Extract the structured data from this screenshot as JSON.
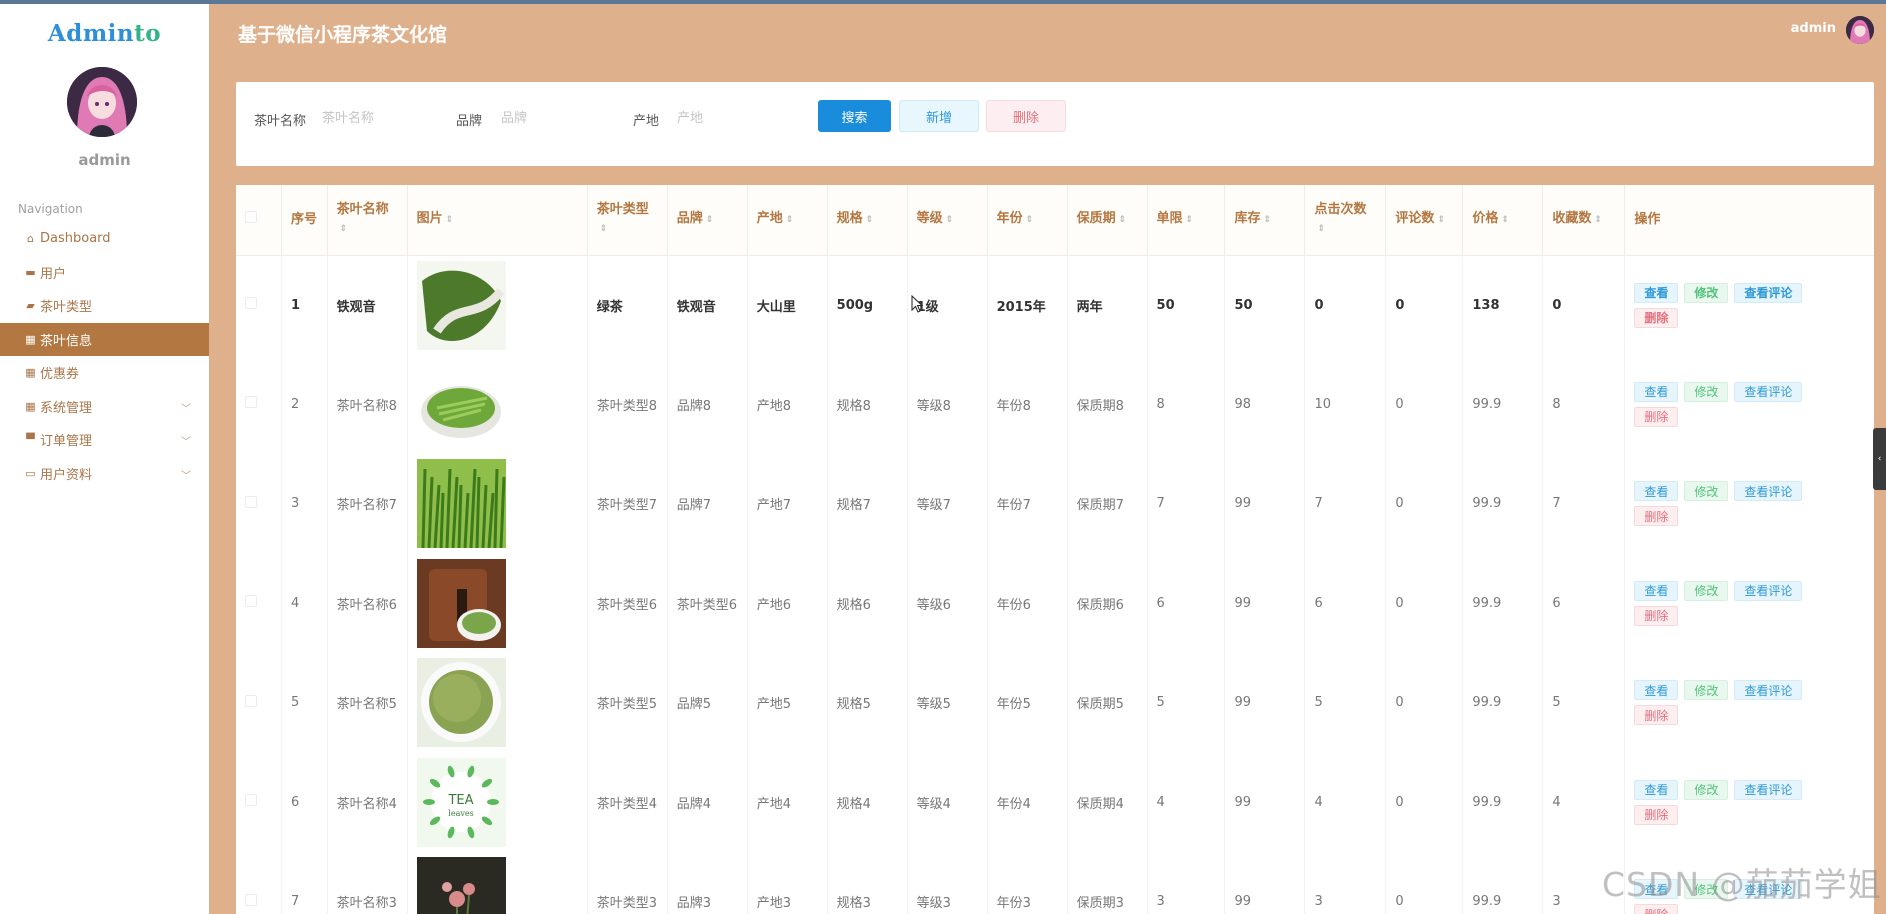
{
  "app": {
    "logo_main": "Admin",
    "logo_accent": "to",
    "title": "基于微信小程序茶文化馆",
    "header_user": "admin",
    "sidebar_user": "admin"
  },
  "sidebar": {
    "heading": "Navigation",
    "items": [
      {
        "label": "Dashboard",
        "icon": "home-icon",
        "glyph": "⌂",
        "active": false,
        "expandable": false
      },
      {
        "label": "用户",
        "icon": "briefcase-icon",
        "glyph": "▬",
        "active": false,
        "expandable": false
      },
      {
        "label": "茶叶类型",
        "icon": "video-icon",
        "glyph": "▰",
        "active": false,
        "expandable": false
      },
      {
        "label": "茶叶信息",
        "icon": "grid-icon",
        "glyph": "▦",
        "active": true,
        "expandable": false
      },
      {
        "label": "优惠券",
        "icon": "grid-icon",
        "glyph": "▦",
        "active": false,
        "expandable": false
      },
      {
        "label": "系统管理",
        "icon": "grid-icon",
        "glyph": "▦",
        "active": false,
        "expandable": true
      },
      {
        "label": "订单管理",
        "icon": "monitor-icon",
        "glyph": "▀",
        "active": false,
        "expandable": true
      },
      {
        "label": "用户资料",
        "icon": "card-icon",
        "glyph": "▭",
        "active": false,
        "expandable": true
      }
    ]
  },
  "search": {
    "fields": [
      {
        "label": "茶叶名称",
        "placeholder": "茶叶名称"
      },
      {
        "label": "品牌",
        "placeholder": "品牌"
      },
      {
        "label": "产地",
        "placeholder": "产地"
      }
    ],
    "search_label": "搜索",
    "add_label": "新增",
    "delete_label": "删除"
  },
  "table": {
    "columns": [
      "序号",
      "茶叶名称",
      "图片",
      "茶叶类型",
      "品牌",
      "产地",
      "规格",
      "等级",
      "年份",
      "保质期",
      "单限",
      "库存",
      "点击次数",
      "评论数",
      "价格",
      "收藏数",
      "操作"
    ],
    "actions": {
      "view": "查看",
      "edit": "修改",
      "comment": "查看评论",
      "delete": "删除"
    },
    "rows": [
      {
        "no": "1",
        "name": "铁观音",
        "type": "绿茶",
        "brand": "铁观音",
        "origin": "大山里",
        "spec": "500g",
        "grade": "1级",
        "year": "2015年",
        "shelf": "两年",
        "limit": "50",
        "stock": "50",
        "clicks": "0",
        "comments": "0",
        "price": "138",
        "favorites": "0",
        "image": {
          "bg": "#f4f6f0",
          "tea": "#4d7a2a",
          "style": "leaf-spoon"
        }
      },
      {
        "no": "2",
        "name": "茶叶名称8",
        "type": "茶叶类型8",
        "brand": "品牌8",
        "origin": "产地8",
        "spec": "规格8",
        "grade": "等级8",
        "year": "年份8",
        "shelf": "保质期8",
        "limit": "8",
        "stock": "98",
        "clicks": "10",
        "comments": "0",
        "price": "99.9",
        "favorites": "8",
        "image": {
          "bg": "#ffffff",
          "tea": "#6ea83a",
          "style": "bowl"
        }
      },
      {
        "no": "3",
        "name": "茶叶名称7",
        "type": "茶叶类型7",
        "brand": "品牌7",
        "origin": "产地7",
        "spec": "规格7",
        "grade": "等级7",
        "year": "年份7",
        "shelf": "保质期7",
        "limit": "7",
        "stock": "99",
        "clicks": "7",
        "comments": "0",
        "price": "99.9",
        "favorites": "7",
        "image": {
          "bg": "#8fbf4a",
          "tea": "#3d7a1c",
          "style": "sprouts"
        }
      },
      {
        "no": "4",
        "name": "茶叶名称6",
        "type": "茶叶类型6",
        "brand": "茶叶类型6",
        "origin": "产地6",
        "spec": "规格6",
        "grade": "等级6",
        "year": "年份6",
        "shelf": "保质期6",
        "limit": "6",
        "stock": "99",
        "clicks": "6",
        "comments": "0",
        "price": "99.9",
        "favorites": "6",
        "image": {
          "bg": "#6b3a22",
          "tea": "#7aa54a",
          "style": "jar"
        }
      },
      {
        "no": "5",
        "name": "茶叶名称5",
        "type": "茶叶类型5",
        "brand": "品牌5",
        "origin": "产地5",
        "spec": "规格5",
        "grade": "等级5",
        "year": "年份5",
        "shelf": "保质期5",
        "limit": "5",
        "stock": "99",
        "clicks": "5",
        "comments": "0",
        "price": "99.9",
        "favorites": "5",
        "image": {
          "bg": "#e9efe2",
          "tea": "#8aa352",
          "style": "plate"
        }
      },
      {
        "no": "6",
        "name": "茶叶名称4",
        "type": "茶叶类型4",
        "brand": "品牌4",
        "origin": "产地4",
        "spec": "规格4",
        "grade": "等级4",
        "year": "年份4",
        "shelf": "保质期4",
        "limit": "4",
        "stock": "99",
        "clicks": "4",
        "comments": "0",
        "price": "99.9",
        "favorites": "4",
        "image": {
          "bg": "#f1f9ee",
          "tea": "#5cb85c",
          "style": "tea-leaves",
          "caption": "TEA",
          "caption2": "leaves"
        }
      },
      {
        "no": "7",
        "name": "茶叶名称3",
        "type": "茶叶类型3",
        "brand": "品牌3",
        "origin": "产地3",
        "spec": "规格3",
        "grade": "等级3",
        "year": "年份3",
        "shelf": "保质期3",
        "limit": "3",
        "stock": "99",
        "clicks": "3",
        "comments": "0",
        "price": "99.9",
        "favorites": "3",
        "image": {
          "bg": "#2b2a22",
          "tea": "#d98a8a",
          "style": "flower"
        }
      }
    ]
  },
  "watermark": "CSDN @茄茄学姐"
}
